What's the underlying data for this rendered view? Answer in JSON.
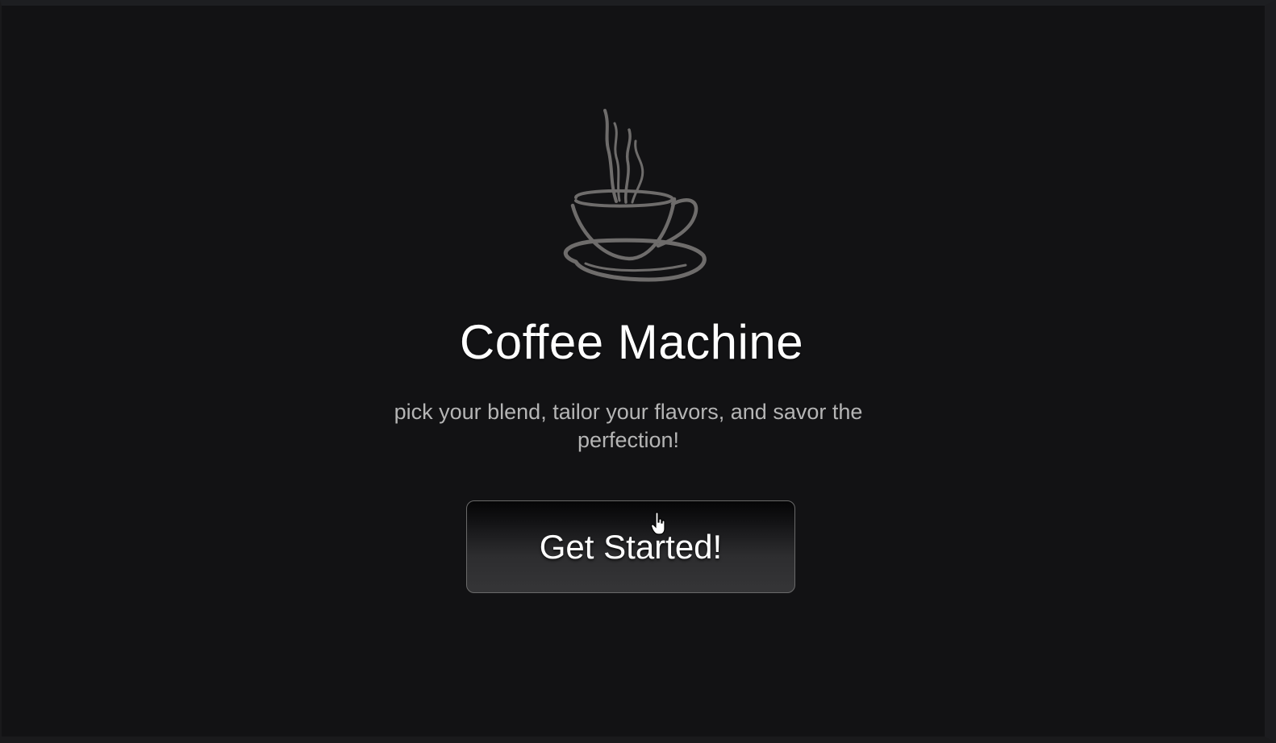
{
  "hero": {
    "logo_icon": "coffee-cup-icon",
    "title": "Coffee Machine",
    "subtitle": "pick your blend, tailor your flavors, and savor the perfection!",
    "cta_label": "Get Started!"
  },
  "colors": {
    "background": "#121214",
    "title": "#ffffff",
    "subtitle": "#b5b5b5",
    "logo_stroke": "#6e6c6b",
    "button_border": "#6a6a6a"
  },
  "cursor_icon": "hand-pointer-icon"
}
